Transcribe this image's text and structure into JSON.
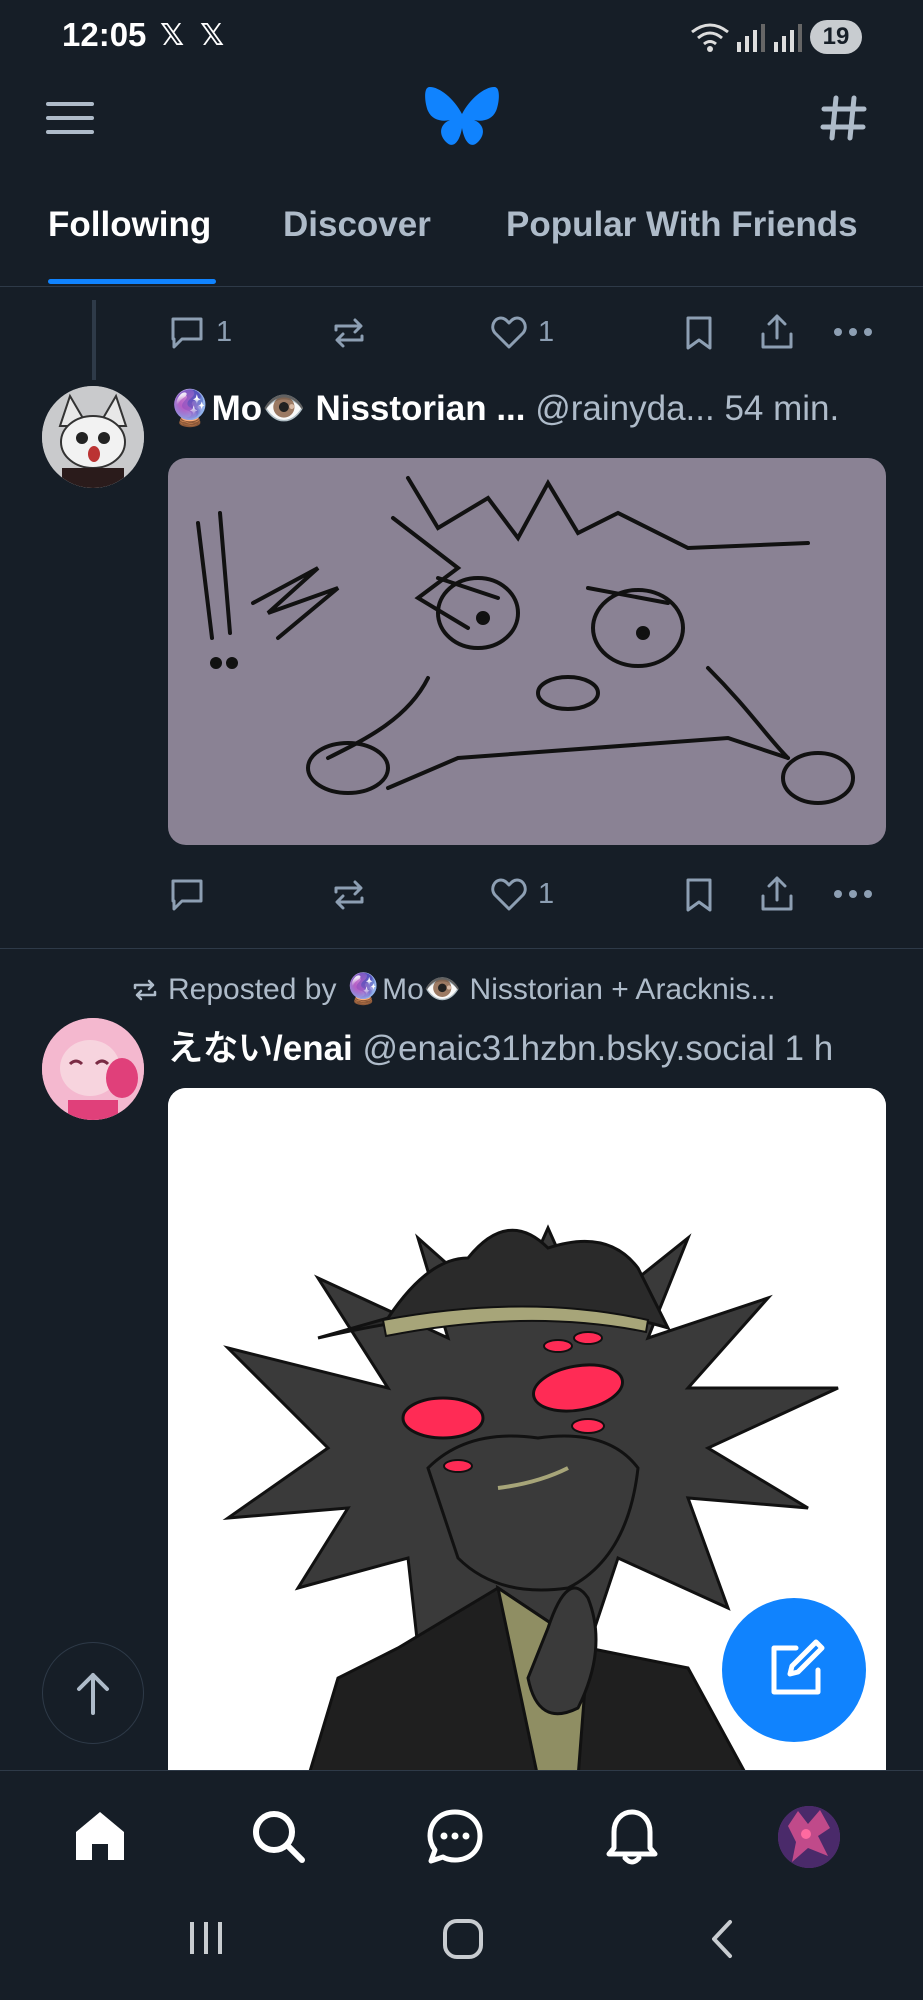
{
  "status_bar": {
    "time": "12:05",
    "notif_icons": [
      "𝕏",
      "𝕏"
    ],
    "battery": "19"
  },
  "header": {
    "menu_icon": "hamburger-icon",
    "logo_icon": "butterfly-logo",
    "feeds_icon": "hash-icon",
    "brand_color": "#1083fe"
  },
  "tabs": [
    {
      "label": "Following",
      "active": true
    },
    {
      "label": "Discover",
      "active": false
    },
    {
      "label": "Popular With Friends",
      "active": false
    }
  ],
  "post_top": {
    "replies": "1",
    "likes": "1"
  },
  "post1": {
    "name_prefix_emoji": "🔮",
    "name_a": "Mo",
    "name_emoji": "👁️",
    "name_b": " Nisstorian ...",
    "handle": " @rainyda...",
    "time": " 54 min.",
    "replies": "",
    "likes": "1"
  },
  "post2": {
    "repost_label": "Reposted by ",
    "repost_emoji_a": "🔮",
    "repost_name_a": "Mo",
    "repost_emoji_b": "👁️",
    "repost_rest": " Nisstorian + Aracknis...",
    "name": "えない/enai",
    "handle": " @enaic31hzbn.bsky.social",
    "time": " 1 h"
  },
  "colors": {
    "background": "#161e27",
    "accent": "#1083fe",
    "muted": "#8d9fb3"
  }
}
